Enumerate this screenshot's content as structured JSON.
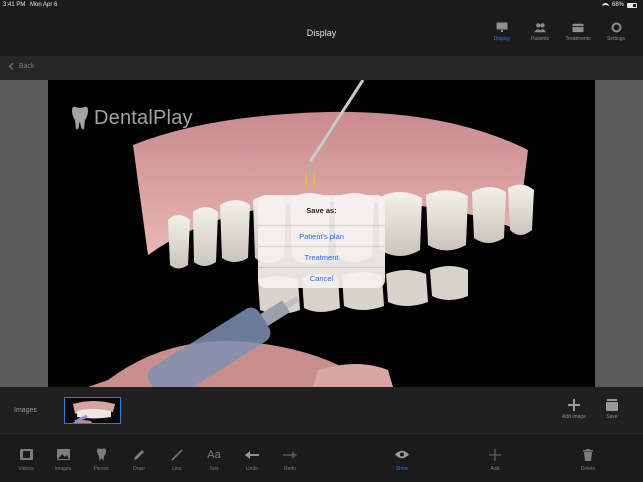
{
  "status_bar": {
    "time": "3:41 PM",
    "date": "Mon Apr 6",
    "battery": "68%",
    "battery_level": 0.68
  },
  "nav": {
    "title": "Display",
    "tabs": [
      {
        "label": "Display",
        "icon": "display-icon",
        "active": true
      },
      {
        "label": "Patients",
        "icon": "patients-icon",
        "active": false
      },
      {
        "label": "Treatments",
        "icon": "treatments-icon",
        "active": false
      },
      {
        "label": "Settings",
        "icon": "settings-icon",
        "active": false
      }
    ]
  },
  "back": {
    "label": "Back"
  },
  "viewer": {
    "brand": "DentalPlay"
  },
  "dialog": {
    "title": "Save as:",
    "options": [
      "Patient's plan",
      "Treatment",
      "Cancel"
    ]
  },
  "images_strip": {
    "label": "Images",
    "add_image_label": "Add image",
    "save_label": "Save"
  },
  "toolbar": {
    "items": [
      {
        "label": "Videos",
        "icon": "videos-icon"
      },
      {
        "label": "Images",
        "icon": "images-icon"
      },
      {
        "label": "Pieces",
        "icon": "tooth-icon"
      },
      {
        "label": "Draw",
        "icon": "pencil-icon"
      },
      {
        "label": "Line",
        "icon": "line-icon"
      },
      {
        "label": "Text",
        "icon": "text-icon"
      },
      {
        "label": "Undo",
        "icon": "undo-arrow-icon"
      },
      {
        "label": "Redo",
        "icon": "redo-arrow-icon"
      },
      {
        "label": "Show",
        "icon": "eye-icon",
        "active": true
      },
      {
        "label": "Add",
        "icon": "plus-icon"
      },
      {
        "label": "Delete",
        "icon": "trash-icon"
      }
    ]
  },
  "colors": {
    "accent": "#2a7de1",
    "background": "#1b1b1b",
    "dialog_bg": "#f6f0ee"
  }
}
